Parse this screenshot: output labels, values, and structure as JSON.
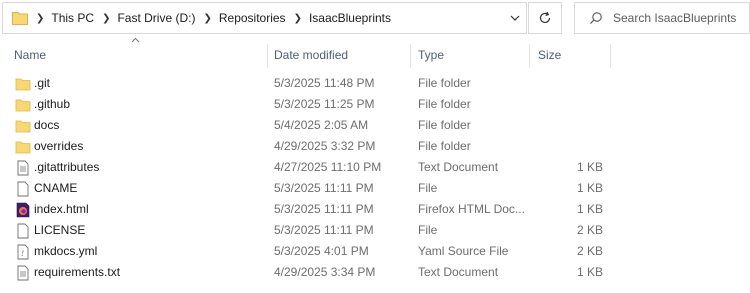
{
  "address": {
    "breadcrumbs": [
      "This PC",
      "Fast Drive (D:)",
      "Repositories",
      "IsaacBlueprints"
    ]
  },
  "search": {
    "placeholder": "Search IsaacBlueprints"
  },
  "columns": {
    "name": "Name",
    "date": "Date modified",
    "type": "Type",
    "size": "Size"
  },
  "files": [
    {
      "name": ".git",
      "date": "5/3/2025 11:48 PM",
      "type": "File folder",
      "size": "",
      "icon": "folder-icon"
    },
    {
      "name": ".github",
      "date": "5/3/2025 11:25 PM",
      "type": "File folder",
      "size": "",
      "icon": "folder-icon"
    },
    {
      "name": "docs",
      "date": "5/4/2025 2:05 AM",
      "type": "File folder",
      "size": "",
      "icon": "folder-icon"
    },
    {
      "name": "overrides",
      "date": "4/29/2025 3:32 PM",
      "type": "File folder",
      "size": "",
      "icon": "folder-icon"
    },
    {
      "name": ".gitattributes",
      "date": "4/27/2025 11:10 PM",
      "type": "Text Document",
      "size": "1 KB",
      "icon": "text-document-icon"
    },
    {
      "name": "CNAME",
      "date": "5/3/2025 11:11 PM",
      "type": "File",
      "size": "1 KB",
      "icon": "file-icon"
    },
    {
      "name": "index.html",
      "date": "5/3/2025 11:11 PM",
      "type": "Firefox HTML Doc...",
      "size": "1 KB",
      "icon": "firefox-html-icon"
    },
    {
      "name": "LICENSE",
      "date": "5/3/2025 11:11 PM",
      "type": "File",
      "size": "2 KB",
      "icon": "file-icon"
    },
    {
      "name": "mkdocs.yml",
      "date": "5/3/2025 4:01 PM",
      "type": "Yaml Source File",
      "size": "2 KB",
      "icon": "yaml-file-icon"
    },
    {
      "name": "requirements.txt",
      "date": "4/29/2025 3:34 PM",
      "type": "Text Document",
      "size": "1 KB",
      "icon": "text-document-icon"
    }
  ]
}
